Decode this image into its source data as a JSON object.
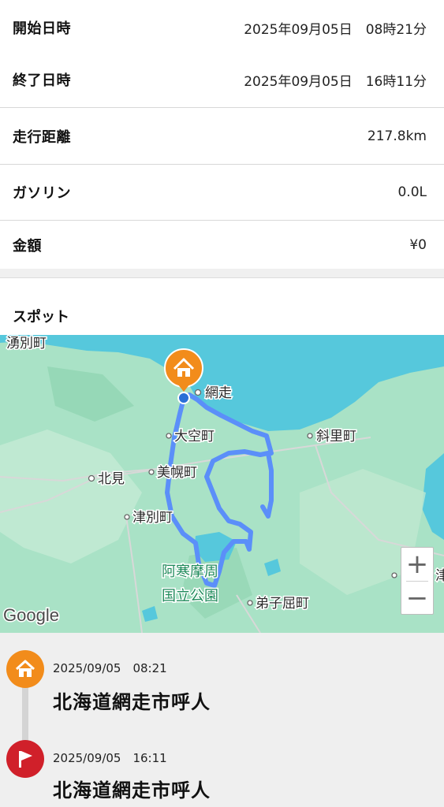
{
  "summary": [
    {
      "label": "開始日時",
      "value": "2025年09月05日　08時21分"
    },
    {
      "label": "終了日時",
      "value": "2025年09月05日　16時11分"
    },
    {
      "label": "走行距離",
      "value": "217.8km"
    },
    {
      "label": "ガソリン",
      "value": "0.0L"
    },
    {
      "label": "金額",
      "value": "¥0"
    }
  ],
  "spots": {
    "title": "スポット",
    "map": {
      "place_labels": {
        "yubetsu": "湧別町",
        "abashiri": "網走",
        "ozora": "大空町",
        "shari": "斜里町",
        "kitami": "北見",
        "bihoro": "美幌町",
        "tsubetsu": "津別町",
        "akan_line1": "阿寒摩周",
        "akan_line2": "国立公園",
        "teshikaga": "弟子屈町",
        "edge": "津"
      },
      "logo": "Google",
      "zoom_in": "+",
      "zoom_out": "−",
      "start_marker_icon": "home-icon"
    },
    "timeline": [
      {
        "date": "2025/09/05　08:21",
        "place": "北海道網走市呼人",
        "icon": "home-icon",
        "color": "#f28c1b"
      },
      {
        "date": "2025/09/05　16:11",
        "place": "北海道網走市呼人",
        "icon": "flag-icon",
        "color": "#d0202a"
      }
    ]
  },
  "colors": {
    "route": "#5b8ff9",
    "sea": "#56c8dc",
    "land": "#a8e0c4",
    "start_marker": "#f28c1b",
    "end_marker": "#d0202a"
  }
}
